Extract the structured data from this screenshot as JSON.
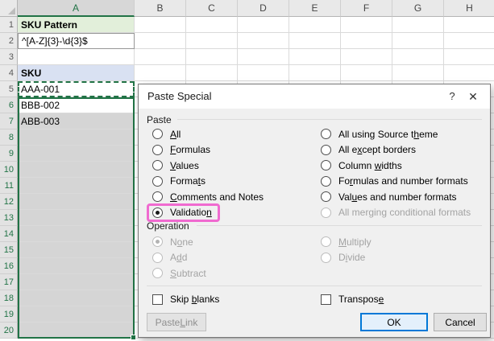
{
  "sheet": {
    "column_headers": [
      "A",
      "B",
      "C",
      "D",
      "E",
      "F",
      "G",
      "H"
    ],
    "selected_column": "A",
    "row_numbers": [
      "1",
      "2",
      "3",
      "4",
      "5",
      "6",
      "7",
      "8",
      "9",
      "10",
      "11",
      "12",
      "13",
      "14",
      "15",
      "16",
      "17",
      "18",
      "19",
      "20"
    ],
    "cells": {
      "1": {
        "text": "SKU Pattern",
        "bold": true,
        "style": "green-fill"
      },
      "2": {
        "text": "^[A-Z]{3}-\\d{3}$",
        "bold": false,
        "style": "outlined"
      },
      "4": {
        "text": "SKU",
        "bold": true,
        "style": "blue-fill"
      },
      "5": {
        "text": "AAA-001"
      },
      "6": {
        "text": "BBB-002"
      },
      "7": {
        "text": "ABB-003"
      }
    },
    "selection": {
      "copied_cell_row": 5,
      "active_cell_row": 6,
      "gray_filled_rows_from": 7,
      "gray_filled_rows_to": 20,
      "green_header_rows_from": 6,
      "green_header_rows_to": 20,
      "accent_color": "#217346",
      "selection_fill": "#d5d5d5"
    }
  },
  "dialog": {
    "title": "Paste Special",
    "help_icon": "?",
    "close_icon": "✕",
    "paste_group": {
      "label": "Paste",
      "left": [
        {
          "label": "All",
          "u": 0
        },
        {
          "label": "Formulas",
          "u": 0
        },
        {
          "label": "Values",
          "u": 0
        },
        {
          "label": "Formats",
          "u": 5
        },
        {
          "label": "Comments and Notes",
          "u": 0
        },
        {
          "label": "Validation",
          "u": 9,
          "selected": true,
          "annotated": true
        }
      ],
      "right": [
        {
          "label": "All using Source theme",
          "u": 18
        },
        {
          "label": "All except borders",
          "u": 5
        },
        {
          "label": "Column widths",
          "u": 7
        },
        {
          "label": "Formulas and number formats",
          "u": 2
        },
        {
          "label": "Values and number formats",
          "u": 3
        },
        {
          "label": "All merging conditional formats",
          "disabled": true
        }
      ]
    },
    "operation_group": {
      "label": "Operation",
      "left": [
        {
          "label": "None",
          "u": 1,
          "selected": true,
          "disabled": true
        },
        {
          "label": "Add",
          "u": 1,
          "disabled": true
        },
        {
          "label": "Subtract",
          "u": 0,
          "disabled": true
        }
      ],
      "right": [
        {
          "label": "Multiply",
          "u": 0,
          "disabled": true
        },
        {
          "label": "Divide",
          "u": 1,
          "disabled": true
        }
      ]
    },
    "checkboxes": [
      {
        "label": "Skip blanks",
        "u": 5,
        "checked": false
      },
      {
        "label": "Transpose",
        "u": 8,
        "checked": false
      }
    ],
    "buttons": [
      {
        "label": "Paste Link",
        "u": 6,
        "disabled": true
      },
      {
        "label": "OK",
        "primary": true
      },
      {
        "label": "Cancel"
      }
    ],
    "ok_accent_color": "#0078d7"
  },
  "annotation": {
    "shape": "rounded-rect",
    "color": "#f06ad0",
    "target": "Validation option"
  }
}
